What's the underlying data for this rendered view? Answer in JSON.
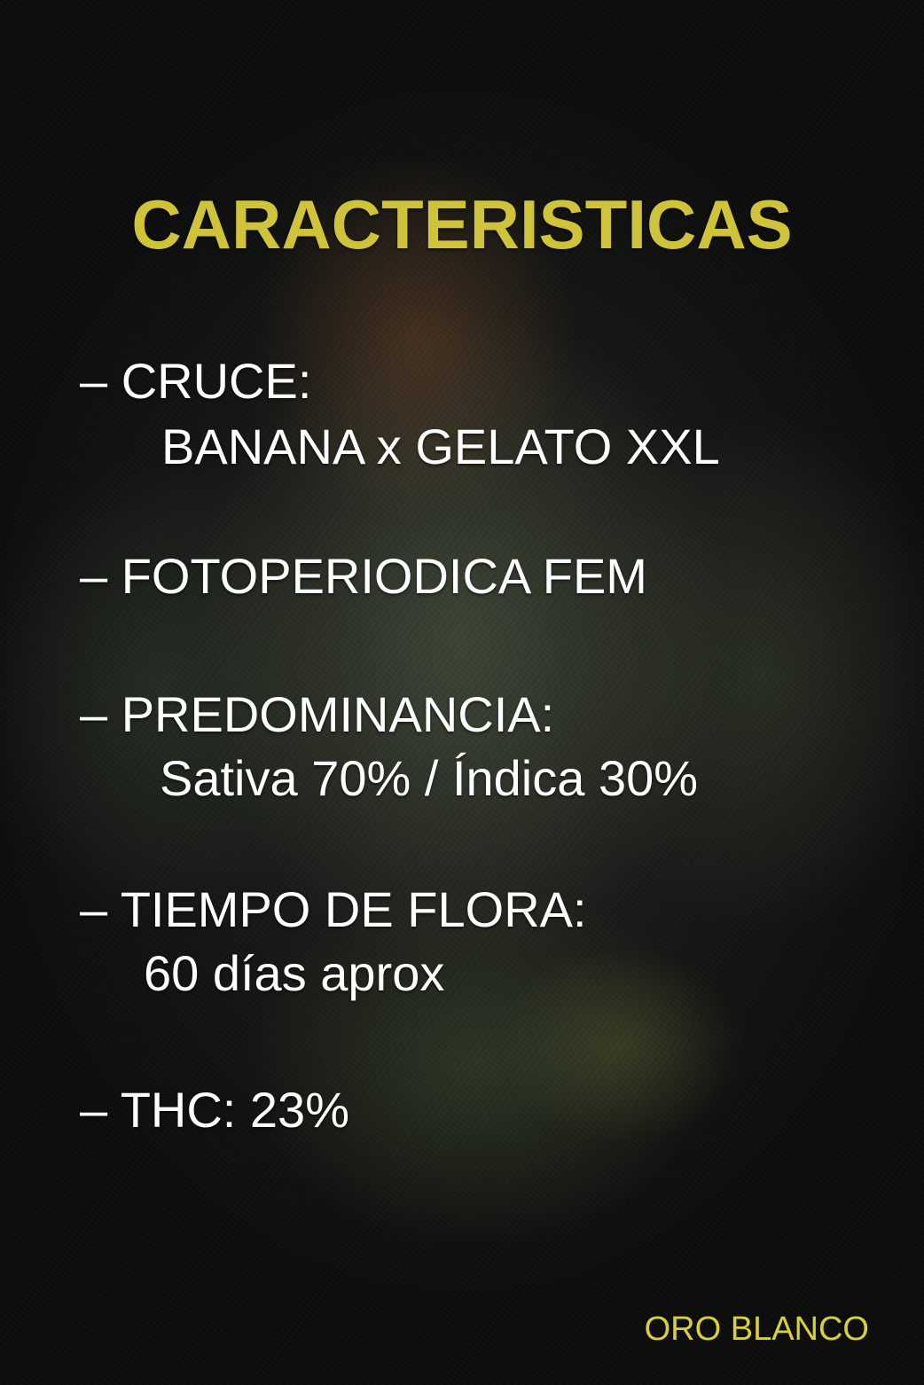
{
  "title": "CARACTERISTICAS",
  "features": {
    "cruce_label": "– CRUCE:",
    "cruce_value": "BANANA x GELATO XXL",
    "fotoperiodica": "– FOTOPERIODICA FEM",
    "predominancia_label": "– PREDOMINANCIA:",
    "predominancia_value": "Sativa 70% / Índica 30%",
    "tiempo_label": "– TIEMPO DE FLORA:",
    "tiempo_value": "60 días aprox",
    "thc": "– THC: 23%"
  },
  "brand": "ORO BLANCO",
  "colors": {
    "title": "#cfc33a",
    "text": "#ffffff",
    "brand": "#d9cf37",
    "background": "#111311"
  }
}
